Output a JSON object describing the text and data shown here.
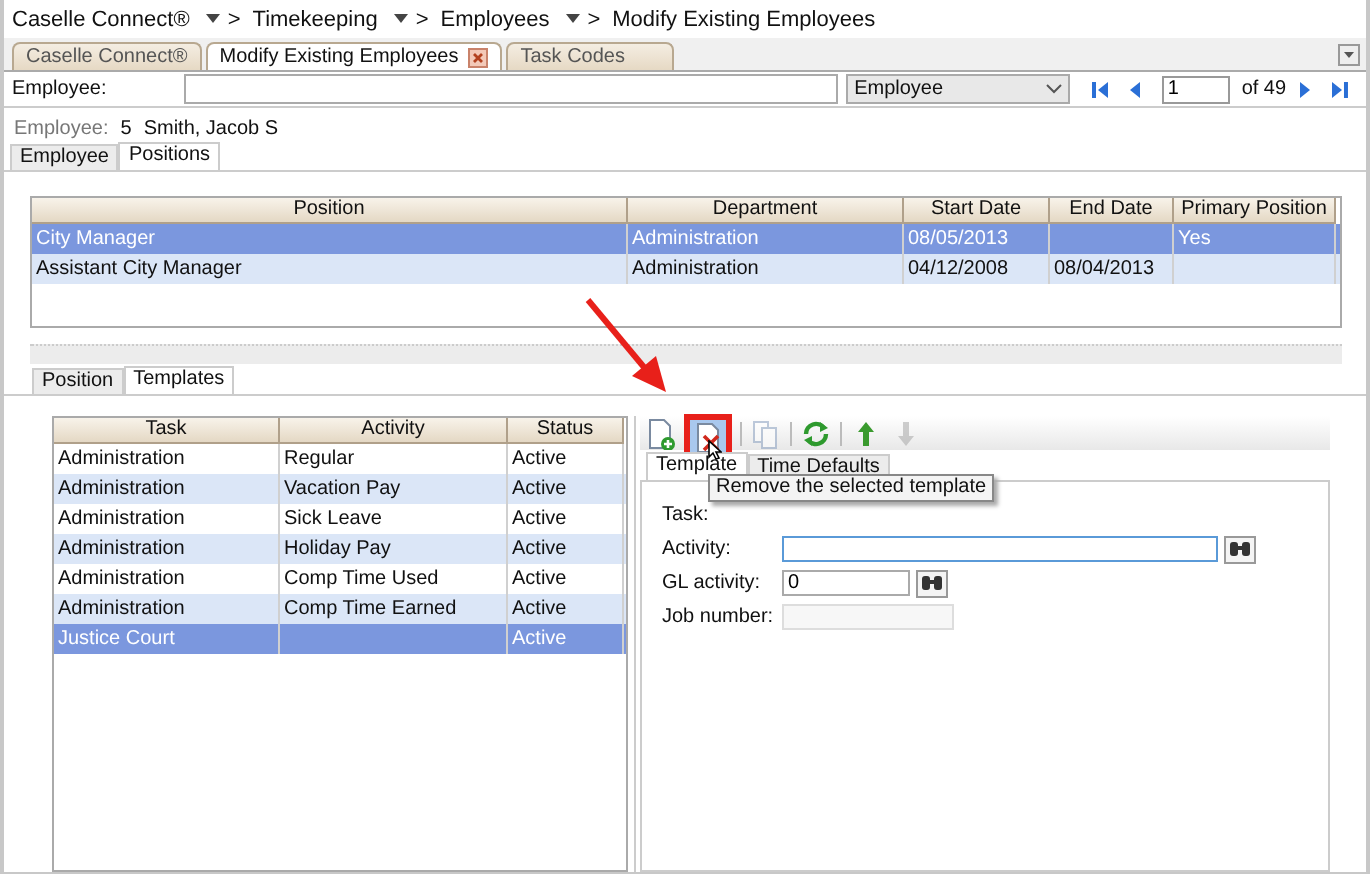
{
  "breadcrumb": {
    "separator": ">",
    "items": [
      {
        "label": "Caselle Connect®",
        "menu": true
      },
      {
        "label": "Timekeeping",
        "menu": true
      },
      {
        "label": "Employees",
        "menu": true
      },
      {
        "label": "Modify Existing Employees",
        "menu": false
      }
    ]
  },
  "doc_tabs": [
    {
      "label": "Caselle Connect®",
      "selected": false,
      "closable": false
    },
    {
      "label": "Modify Existing Employees",
      "selected": true,
      "closable": true
    },
    {
      "label": "Task Codes",
      "selected": false,
      "closable": false
    }
  ],
  "search": {
    "label": "Employee:",
    "field": "Employee",
    "page": "1",
    "page_count": "of 49"
  },
  "employee": {
    "label": "Employee:",
    "number": "5",
    "name": "Smith, Jacob S"
  },
  "section_tabs": [
    {
      "label": "Employee",
      "selected": false
    },
    {
      "label": "Positions",
      "selected": true
    }
  ],
  "positions": {
    "columns": [
      "Position",
      "Department",
      "Start Date",
      "End Date",
      "Primary Position"
    ],
    "rows": [
      {
        "cells": [
          "City Manager",
          "Administration",
          "08/05/2013",
          "",
          "Yes"
        ],
        "selected": true
      },
      {
        "cells": [
          "Assistant City Manager",
          "Administration",
          "04/12/2008",
          "08/04/2013",
          ""
        ],
        "selected": false
      }
    ]
  },
  "position_tabs": [
    {
      "label": "Position",
      "selected": false
    },
    {
      "label": "Templates",
      "selected": true
    }
  ],
  "templates": {
    "columns": [
      "Task",
      "Activity",
      "Status"
    ],
    "rows": [
      {
        "cells": [
          "Administration",
          "Regular",
          "Active"
        ],
        "selected": false
      },
      {
        "cells": [
          "Administration",
          "Vacation Pay",
          "Active"
        ],
        "selected": false
      },
      {
        "cells": [
          "Administration",
          "Sick Leave",
          "Active"
        ],
        "selected": false
      },
      {
        "cells": [
          "Administration",
          "Holiday Pay",
          "Active"
        ],
        "selected": false
      },
      {
        "cells": [
          "Administration",
          "Comp Time Used",
          "Active"
        ],
        "selected": false
      },
      {
        "cells": [
          "Administration",
          "Comp Time Earned",
          "Active"
        ],
        "selected": false
      },
      {
        "cells": [
          "Justice Court",
          "",
          "Active"
        ],
        "selected": true
      }
    ]
  },
  "toolbar": [
    {
      "kind": "add",
      "disabled": false,
      "highlighted": false
    },
    {
      "kind": "remove",
      "disabled": false,
      "highlighted": true
    },
    {
      "kind": "copy",
      "disabled": true,
      "highlighted": false
    },
    {
      "kind": "refresh",
      "disabled": false,
      "highlighted": false
    },
    {
      "kind": "up",
      "disabled": false,
      "highlighted": false
    },
    {
      "kind": "down",
      "disabled": true,
      "highlighted": false
    }
  ],
  "detail_tabs": [
    {
      "label": "Template",
      "selected": true
    },
    {
      "label": "Time Defaults",
      "selected": false
    }
  ],
  "tooltip": "Remove the selected template",
  "form": [
    {
      "label": "Task:",
      "kind": "hidden"
    },
    {
      "label": "Activity:",
      "kind": "lookup",
      "focused": true
    },
    {
      "label": "GL activity:",
      "kind": "lookup",
      "value": "0",
      "focused": false
    },
    {
      "label": "Job number:",
      "kind": "text",
      "disabled": true
    }
  ]
}
